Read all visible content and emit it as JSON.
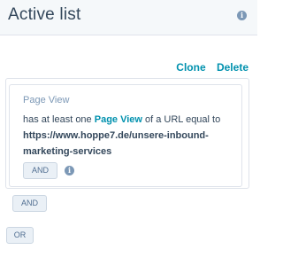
{
  "header": {
    "title": "Active list"
  },
  "actions": {
    "clone_label": "Clone",
    "delete_label": "Delete"
  },
  "filter": {
    "type_label": "Page View",
    "desc_prefix": "has at least one",
    "desc_link": "Page View",
    "desc_suffix": "of a URL equal to",
    "url": "https://www.hoppe7.de/unsere-inbound-marketing-services",
    "and_button": "AND"
  },
  "group": {
    "and_button": "AND"
  },
  "or_button": "OR",
  "colors": {
    "header_bg": "#f5f8fa",
    "link": "#0091ae",
    "text": "#33475b",
    "muted": "#7c98b6",
    "button_bg": "#eaf0f6",
    "border": "#dfe3eb"
  }
}
